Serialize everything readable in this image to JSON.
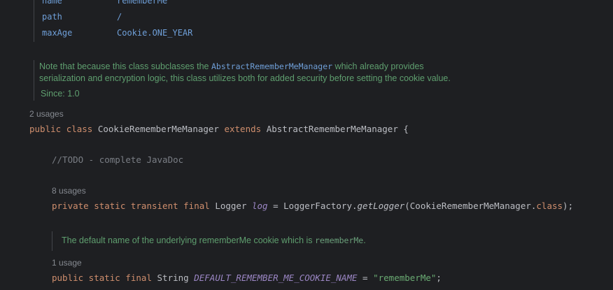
{
  "doc_table": [
    {
      "key": "name",
      "value": "rememberMe"
    },
    {
      "key": "path",
      "value": "/"
    },
    {
      "key": "maxAge",
      "value": "Cookie.ONE_YEAR"
    }
  ],
  "class_doc": {
    "line1_prefix": "Note that because this class subclasses the ",
    "line1_link": "AbstractRememberMeManager",
    "line1_suffix": " which already provides",
    "line2": "serialization and encryption logic, this class utilizes both for added security before setting the cookie value.",
    "since": "Since: 1.0"
  },
  "class_decl": {
    "usages": "2 usages",
    "kw_public": "public",
    "kw_class": "class",
    "name": "CookieRememberMeManager",
    "kw_extends": "extends",
    "super": "AbstractRememberMeManager",
    "brace": " {"
  },
  "todo_comment": "//TODO - complete JavaDoc",
  "log_field": {
    "usages": "8 usages",
    "modifiers": "private static transient final",
    "type": "Logger",
    "name": "log",
    "assign": " = LoggerFactory.",
    "method": "getLogger",
    "arg": "(CookieRememberMeManager.",
    "kw_class": "class",
    "end": ");"
  },
  "field_doc": {
    "text": "The default name of the underlying rememberMe cookie which is ",
    "code": "rememberMe",
    "end": "."
  },
  "cookie_field": {
    "usages": "1 usage",
    "modifiers": "public static final",
    "type": "String",
    "name": "DEFAULT_REMEMBER_ME_COOKIE_NAME",
    "assign": " = ",
    "value": "\"rememberMe\"",
    "end": ";"
  }
}
